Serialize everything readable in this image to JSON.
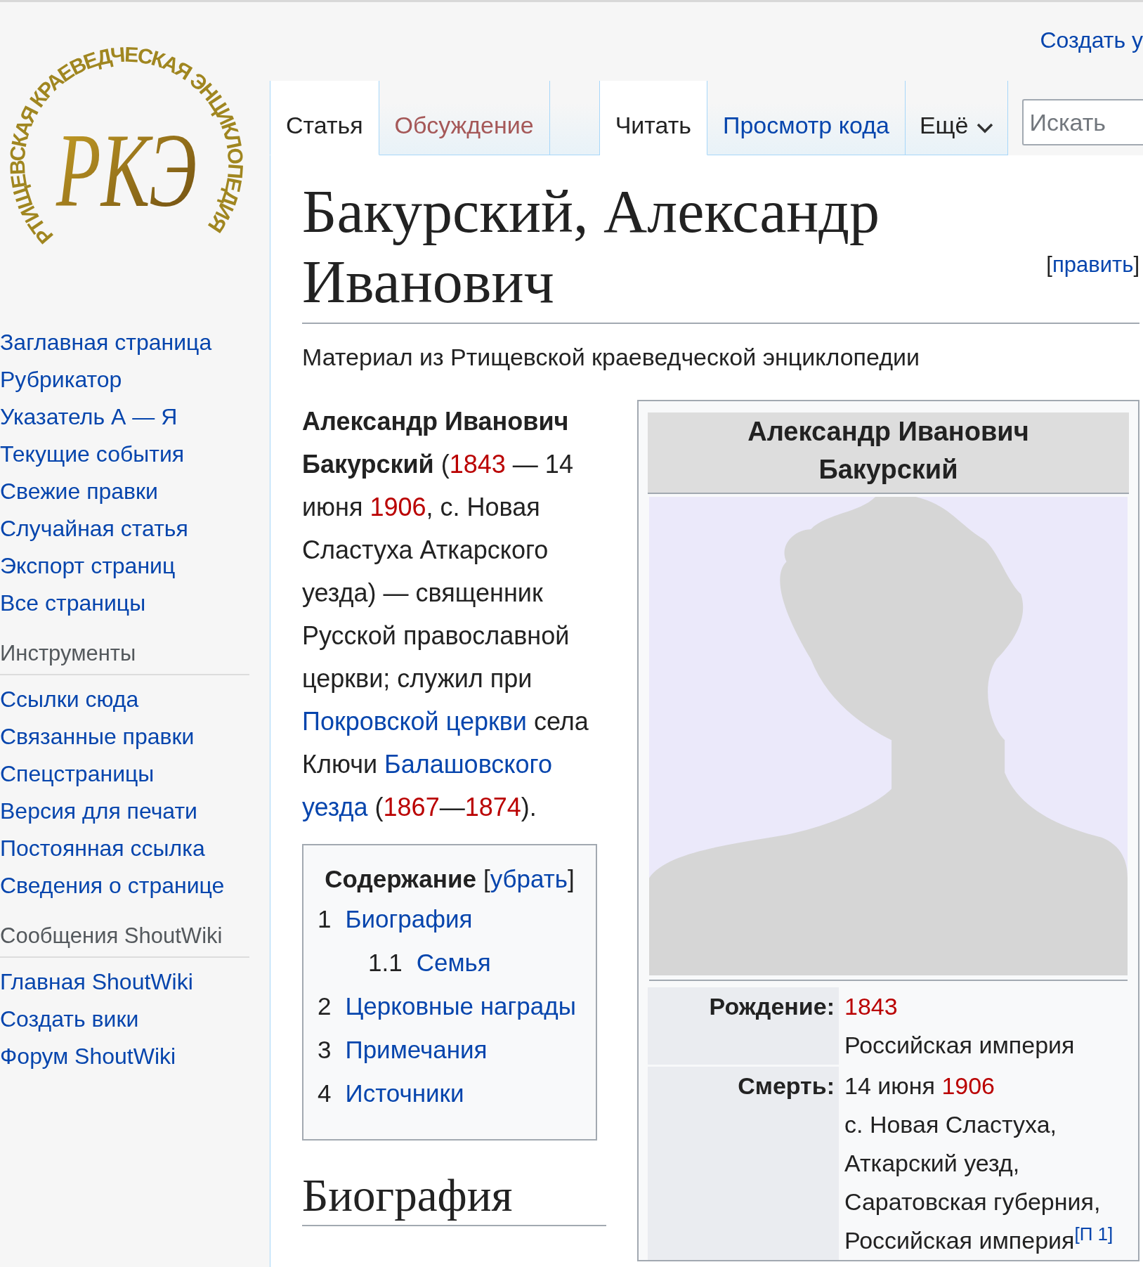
{
  "personal_link": "Создать у",
  "logo": {
    "ring_text": "РТИЩЕВСКАЯ КРАЕВЕДЧЕСКАЯ ЭНЦИКЛОПЕДИЯ",
    "monogram": "РКЭ"
  },
  "nav": [
    {
      "label": "Заглавная страница"
    },
    {
      "label": "Рубрикатор"
    },
    {
      "label": "Указатель А — Я"
    },
    {
      "label": "Текущие события"
    },
    {
      "label": "Свежие правки"
    },
    {
      "label": "Случайная статья"
    },
    {
      "label": "Экспорт страниц"
    },
    {
      "label": "Все страницы"
    }
  ],
  "portals": [
    {
      "heading": "Инструменты",
      "items": [
        {
          "label": "Ссылки сюда"
        },
        {
          "label": "Связанные правки"
        },
        {
          "label": "Спецстраницы"
        },
        {
          "label": "Версия для печати"
        },
        {
          "label": "Постоянная ссылка"
        },
        {
          "label": "Сведения о странице"
        }
      ]
    },
    {
      "heading": "Сообщения ShoutWiki",
      "items": [
        {
          "label": "Главная ShoutWiki"
        },
        {
          "label": "Создать вики"
        },
        {
          "label": "Форум ShoutWiki"
        }
      ]
    }
  ],
  "tabs_left": [
    {
      "label": "Статья",
      "selected": true,
      "kind": "link"
    },
    {
      "label": "Обсуждение",
      "selected": false,
      "kind": "redlink"
    }
  ],
  "tabs_right": [
    {
      "label": "Читать",
      "selected": true,
      "kind": "link"
    },
    {
      "label": "Просмотр кода",
      "selected": false,
      "kind": "link"
    }
  ],
  "more_menu": {
    "label": "Ещё"
  },
  "search": {
    "placeholder": "Искать"
  },
  "article": {
    "title": "Бакурский, Александр Иванович",
    "edit_link": "[править]",
    "subtitle": "Материал из Ртищевской краеведческой энциклопедии",
    "intro": [
      {
        "kind": "bold",
        "text": "Александр Иванович Бакурский"
      },
      {
        "kind": "text",
        "text": " ("
      },
      {
        "kind": "redlink",
        "text": "1843"
      },
      {
        "kind": "text",
        "text": " — 14 июня "
      },
      {
        "kind": "redlink",
        "text": "1906"
      },
      {
        "kind": "text",
        "text": ", с. Новая Сластуха Аткарского уезда) — священник Русской православной церкви; служил при "
      },
      {
        "kind": "link",
        "text": "Покровской церкви"
      },
      {
        "kind": "text",
        "text": " села Ключи "
      },
      {
        "kind": "link",
        "text": "Балашовского"
      },
      {
        "kind": "link",
        "text": "уезда",
        "space_before": true
      },
      {
        "kind": "text",
        "text": " ("
      },
      {
        "kind": "redlink",
        "text": "1867"
      },
      {
        "kind": "text",
        "text": "—"
      },
      {
        "kind": "redlink",
        "text": "1874"
      },
      {
        "kind": "text",
        "text": ")."
      }
    ],
    "toc": {
      "title": "Содержание",
      "toggle": "[убрать]",
      "items": [
        {
          "number": "1",
          "label": "Биография",
          "children": [
            {
              "number": "1.1",
              "label": "Семья"
            }
          ]
        },
        {
          "number": "2",
          "label": "Церковные награды"
        },
        {
          "number": "3",
          "label": "Примечания"
        },
        {
          "number": "4",
          "label": "Источники"
        }
      ]
    },
    "section_heading": "Биография",
    "infobox": {
      "title": "Александр Иванович Бакурский",
      "rows": [
        {
          "label": "Рождение:",
          "lines": [
            [
              {
                "kind": "redlink",
                "text": "1843"
              }
            ],
            [
              {
                "kind": "text",
                "text": "Российская империя"
              }
            ]
          ]
        },
        {
          "label": "Смерть:",
          "lines": [
            [
              {
                "kind": "text",
                "text": "14 июня "
              },
              {
                "kind": "redlink",
                "text": "1906"
              }
            ],
            [
              {
                "kind": "text",
                "text": "с. Новая Сластуха,"
              }
            ],
            [
              {
                "kind": "text",
                "text": "Аткарский уезд,"
              }
            ],
            [
              {
                "kind": "text",
                "text": "Саратовская губерния,"
              }
            ],
            [
              {
                "kind": "text",
                "text": "Российская империя"
              },
              {
                "kind": "ref",
                "text": "[П 1]"
              }
            ]
          ]
        }
      ]
    }
  }
}
